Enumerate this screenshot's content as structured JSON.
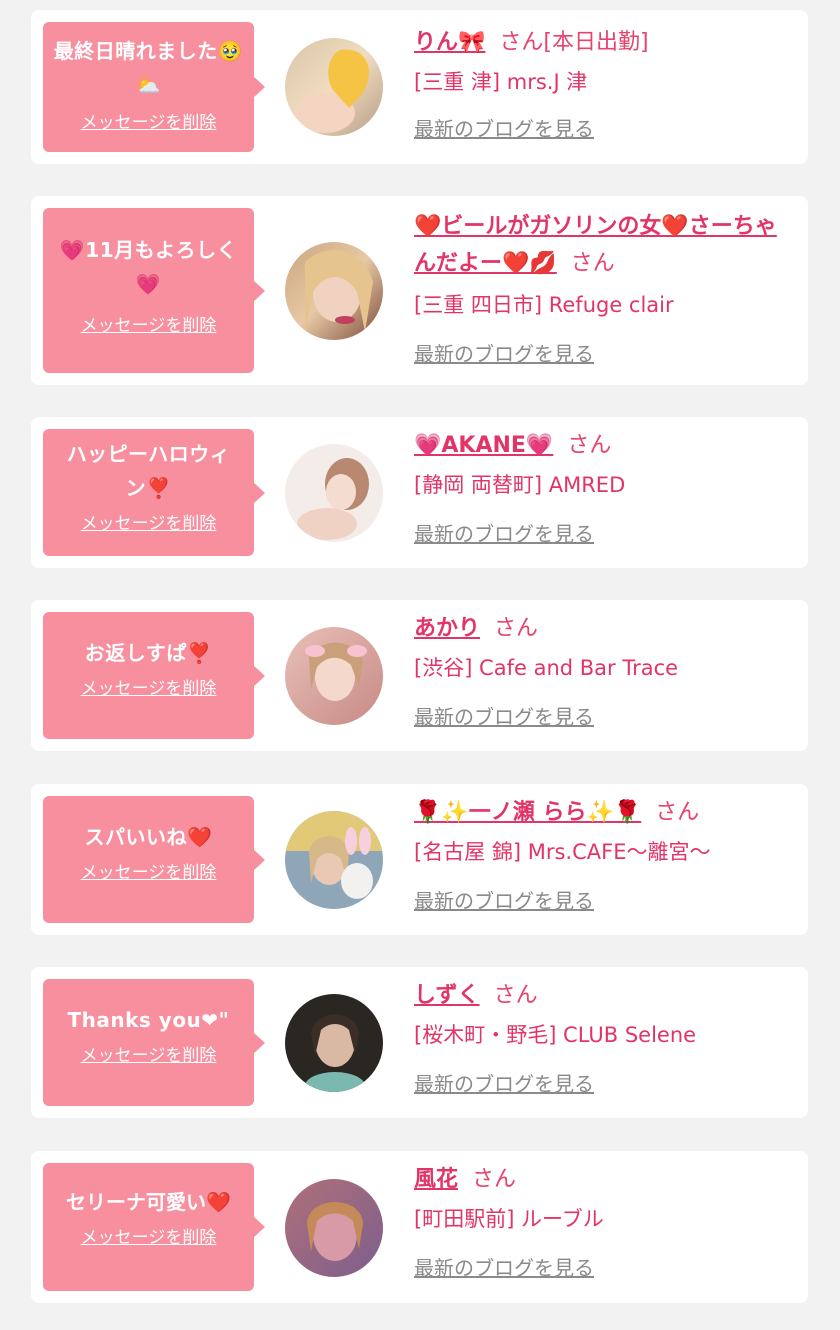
{
  "items": [
    {
      "message": "最終日晴れました🥹⛅",
      "delete_label": "メッセージを削除",
      "name": "りん🎀",
      "honorific": "さん[本日出勤]",
      "shop": "[三重 津] mrs.J 津",
      "blog_label": "最新のブログを見る"
    },
    {
      "message": "💗11月もよろしく💗",
      "delete_label": "メッセージを削除",
      "name": "❤️ビールがガソリンの女❤️さーちゃんだよー❤️💋",
      "honorific": "さん",
      "shop": "[三重 四日市] Refuge clair",
      "blog_label": "最新のブログを見る"
    },
    {
      "message": "ハッピーハロウィン❣️",
      "delete_label": "メッセージを削除",
      "name": "💗AKANE💗",
      "honorific": "さん",
      "shop": "[静岡 両替町] AMRED",
      "blog_label": "最新のブログを見る"
    },
    {
      "message": "お返しすぱ❣️",
      "delete_label": "メッセージを削除",
      "name": "あかり",
      "honorific": "さん",
      "shop": "[渋谷] Cafe and Bar Trace",
      "blog_label": "最新のブログを見る"
    },
    {
      "message": "スパいいね❤️",
      "delete_label": "メッセージを削除",
      "name": "🌹✨一ノ瀬 らら✨🌹",
      "honorific": "さん",
      "shop": "[名古屋 錦] Mrs.CAFE～離宮～",
      "blog_label": "最新のブログを見る"
    },
    {
      "message": "Thanks you❤\"",
      "delete_label": "メッセージを削除",
      "name": "しずく",
      "honorific": "さん",
      "shop": "[桜木町・野毛] CLUB Selene",
      "blog_label": "最新のブログを見る"
    },
    {
      "message": "セリーナ可愛い❤️",
      "delete_label": "メッセージを削除",
      "name": "風花",
      "honorific": "さん",
      "shop": "[町田駅前] ルーブル",
      "blog_label": "最新のブログを見る"
    }
  ],
  "colors": {
    "background": "#f2f2f2",
    "bubble": "#f78f9e",
    "name": "#e23466",
    "link_gray": "#8a8a8a"
  }
}
